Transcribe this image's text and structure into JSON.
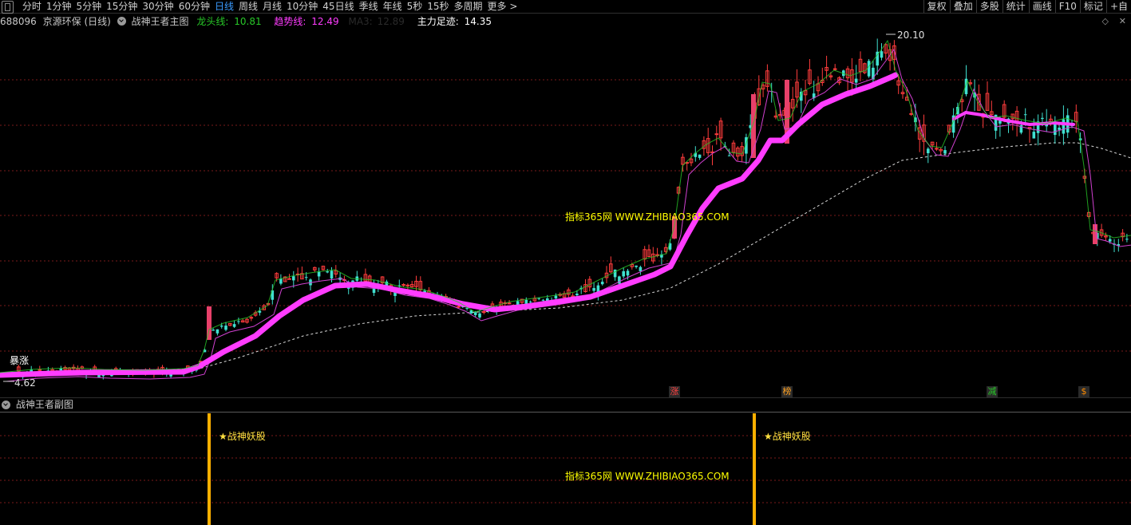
{
  "toolbar": {
    "periods": [
      {
        "label": "分时"
      },
      {
        "label": "1分钟"
      },
      {
        "label": "5分钟"
      },
      {
        "label": "15分钟"
      },
      {
        "label": "30分钟"
      },
      {
        "label": "60分钟"
      },
      {
        "label": "日线",
        "active": true
      },
      {
        "label": "周线"
      },
      {
        "label": "月线"
      },
      {
        "label": "10分钟"
      },
      {
        "label": "45日线"
      },
      {
        "label": "季线"
      },
      {
        "label": "年线"
      },
      {
        "label": "5秒"
      },
      {
        "label": "15秒"
      },
      {
        "label": "多周期"
      },
      {
        "label": "更多 >"
      }
    ],
    "tools": [
      "复权",
      "叠加",
      "多股",
      "统计",
      "画线",
      "F10",
      "标记",
      "+自"
    ]
  },
  "info": {
    "code": "688096",
    "name": "京源环保",
    "period": "(日线)",
    "indicator": "战神王者主图",
    "dragon_label": "龙头线:",
    "dragon_value": "10.81",
    "trend_label": "趋势线:",
    "trend_value": "12.49",
    "ma_label": "MA3:",
    "ma_value": "12.89",
    "main_force_label": "主力足迹:",
    "main_force_value": "14.35"
  },
  "colors": {
    "dragon": "#28c828",
    "trend": "#ff3cff",
    "main_force": "#ffffff",
    "up_candle": "#ff3c3c",
    "down_candle": "#40e0d0",
    "white_dash": "#d8d8d8",
    "signal_bar": "#ffb000",
    "signal_text": "#ffe040",
    "watermark": "#ffff00",
    "grid": "#7a1a1a"
  },
  "main_chart": {
    "high_label": "20.10",
    "low_label": "4.62",
    "burst_label": "暴涨",
    "watermark": "指标365网 WWW.ZHIBIAO365.COM",
    "tags": [
      {
        "text": "涨",
        "color": "#ff4040"
      },
      {
        "text": "榜",
        "color": "#ffa020"
      },
      {
        "text": "减",
        "color": "#28c828"
      },
      {
        "text": "$",
        "color": "#ff8c00"
      }
    ]
  },
  "sub_chart": {
    "title": "战神王者副图",
    "signals": [
      "★战神妖股",
      "★战神妖股"
    ],
    "watermark": "指标365网 WWW.ZHIBIAO365.COM"
  }
}
